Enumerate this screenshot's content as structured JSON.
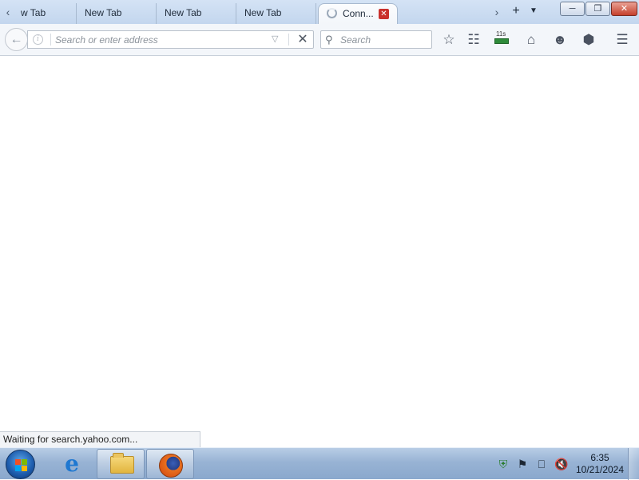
{
  "browser": {
    "tabs": [
      {
        "label": "w Tab"
      },
      {
        "label": "New Tab"
      },
      {
        "label": "New Tab"
      },
      {
        "label": "New Tab"
      },
      {
        "label": "Conn...",
        "active": true,
        "loading": true
      }
    ],
    "tab_scroll_left_icon": "chevron-left-icon",
    "tab_scroll_right_icon": "chevron-right-icon",
    "new_tab_icon": "plus-icon",
    "all_tabs_icon": "chevron-down-icon",
    "window_controls": {
      "minimize_icon": "minimize-icon",
      "maximize_icon": "restore-icon",
      "close_icon": "close-icon"
    },
    "navigation": {
      "back_icon": "back-arrow-icon",
      "identity_icon": "info-icon",
      "address_placeholder": "Search or enter address",
      "address_value": "",
      "history_dropmarker_icon": "triangle-down-icon",
      "stop_icon": "close-icon",
      "search_placeholder": "Search",
      "search_value": ""
    },
    "toolbar_icons": [
      "bookmark-star-icon",
      "reading-list-icon",
      "speed-dial-badge-icon",
      "home-icon",
      "smiley-feedback-icon",
      "pocket-icon",
      "menu-icon"
    ],
    "badge_text": "11s",
    "status_text": "Waiting for search.yahoo.com..."
  },
  "taskbar": {
    "start_icon": "windows-start-orb-icon",
    "pinned": [
      {
        "name": "internet-explorer-icon"
      },
      {
        "name": "file-explorer-icon"
      },
      {
        "name": "firefox-icon",
        "active": true
      }
    ],
    "tray_icons": [
      "security-shield-icon",
      "action-center-flag-icon",
      "network-icon",
      "volume-muted-icon"
    ],
    "clock_time": "6:35",
    "clock_date": "10/21/2024"
  },
  "colors": {
    "titlebar": "#c3d6ee",
    "toolbar": "#f3f6fa",
    "close_red": "#c5402c",
    "taskbar": "#98b3d4"
  }
}
